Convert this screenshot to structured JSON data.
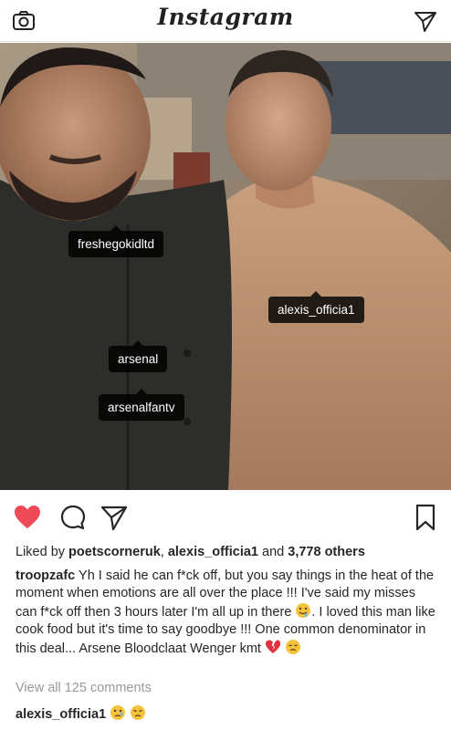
{
  "header": {
    "app_title": "Instagram",
    "camera_icon": "camera-icon",
    "direct_icon": "paper-plane-icon"
  },
  "post": {
    "tags": [
      {
        "label": "freshegokidltd"
      },
      {
        "label": "alexis_officia1"
      },
      {
        "label": "arsenal"
      },
      {
        "label": "arsenalfantv"
      }
    ],
    "actions": {
      "like_icon": "heart-filled-icon",
      "comment_icon": "comment-icon",
      "share_icon": "paper-plane-icon",
      "save_icon": "bookmark-icon",
      "like_color": "#ed4956"
    },
    "likes": {
      "prefix": "Liked by ",
      "user1": "poetscorneruk",
      "sep": ", ",
      "user2": "alexis_officia1",
      "middle": " and ",
      "count": "3,778 others"
    },
    "caption": {
      "username": "troopzafc",
      "text_part1": " Yh I said he can f*ck off, but you say things in the heat of the moment when emotions are all over the place !!! I've said my misses can f*ck off then 3 hours later I'm all up in there ",
      "text_part2": ". I loved this man like cook food but it's time to say goodbye !!! One common denominator in this deal... Arsene Bloodclaat Wenger kmt "
    },
    "view_all_comments": "View all 125 comments",
    "comment": {
      "username": "alexis_officia1"
    }
  }
}
